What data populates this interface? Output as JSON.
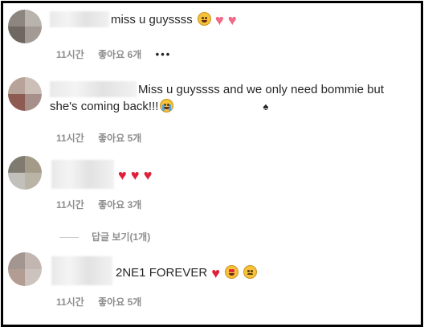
{
  "comments": [
    {
      "text": "miss u guyssss",
      "time": "11시간",
      "likes": "좋아요 6개",
      "more": "•••",
      "avatar_colors": [
        "#8c8580",
        "#b9b3ad",
        "#6f6761",
        "#a39b93"
      ]
    },
    {
      "text": "Miss u guyssss and we only need bommie but she's coming back!!!",
      "time": "11시간",
      "likes": "좋아요 5개",
      "avatar_colors": [
        "#b8a39a",
        "#cbbfb8",
        "#8e5b52",
        "#a7908a"
      ]
    },
    {
      "text": "",
      "time": "11시간",
      "likes": "좋아요 3개",
      "avatar_colors": [
        "#7f7b70",
        "#a39a88",
        "#c2c0bb",
        "#bab4a6"
      ]
    },
    {
      "text": "2NE1 FOREVER",
      "time": "11시간",
      "likes": "좋아요 5개",
      "avatar_colors": [
        "#a39590",
        "#c3b6b1",
        "#b29c94",
        "#ccc3bf"
      ]
    }
  ],
  "reply_toggle": "답글 보기(1개)",
  "colors": {
    "meta": "#8e8e8e",
    "text": "#262626",
    "heart_red": "#e0203a",
    "heart_pink": "#f16a86"
  }
}
